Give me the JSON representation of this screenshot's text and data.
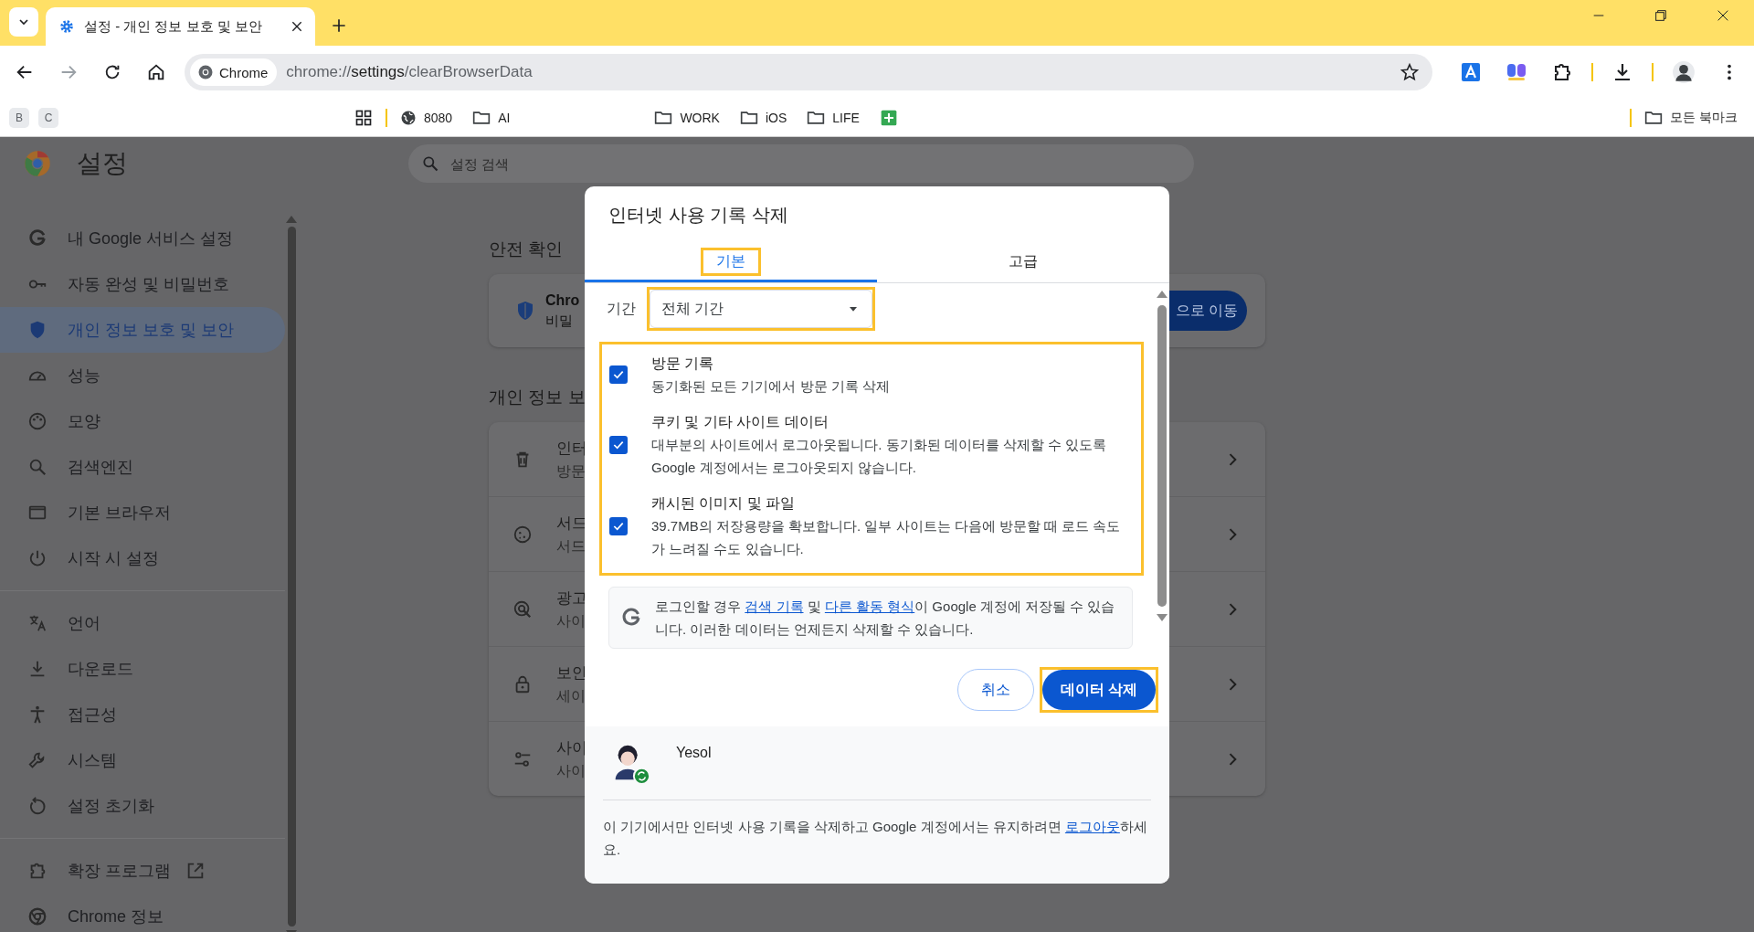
{
  "browser": {
    "tab": {
      "title": "설정 - 개인 정보 보호 및 보안"
    },
    "address": {
      "chip": "Chrome",
      "url": "chrome://**settings**/clearBrowserData"
    },
    "bookmarks_left": [
      "B",
      "C"
    ],
    "bookmarks": [
      {
        "kind": "apps"
      },
      {
        "kind": "site",
        "label": "8080"
      },
      {
        "kind": "folder",
        "label": "AI"
      },
      {
        "kind": "gap"
      },
      {
        "kind": "folder",
        "label": "WORK"
      },
      {
        "kind": "folder",
        "label": "iOS"
      },
      {
        "kind": "folder",
        "label": "LIFE"
      },
      {
        "kind": "sheet"
      }
    ],
    "all_bookmarks": "모든 북마크"
  },
  "settings": {
    "title": "설정",
    "search": {
      "placeholder": "설정 검색"
    },
    "sidebar": {
      "groups": [
        [
          {
            "label": "내 Google 서비스 설정",
            "selected": false
          },
          {
            "label": "자동 완성 및 비밀번호",
            "selected": false
          },
          {
            "label": "개인 정보 보호 및 보안",
            "selected": true
          },
          {
            "label": "성능",
            "selected": false
          },
          {
            "label": "모양",
            "selected": false
          },
          {
            "label": "검색엔진",
            "selected": false
          },
          {
            "label": "기본 브라우저",
            "selected": false
          },
          {
            "label": "시작 시 설정",
            "selected": false
          }
        ],
        [
          {
            "label": "언어",
            "selected": false
          },
          {
            "label": "다운로드",
            "selected": false
          },
          {
            "label": "접근성",
            "selected": false
          },
          {
            "label": "시스템",
            "selected": false
          },
          {
            "label": "설정 초기화",
            "selected": false
          }
        ],
        [
          {
            "label": "확장 프로그램",
            "selected": false,
            "external": true
          },
          {
            "label": "Chrome 정보",
            "selected": false,
            "external": false
          }
        ]
      ]
    },
    "safety": {
      "heading": "안전 확인",
      "title": "Chro",
      "subtitle": "비밀",
      "button": "으로 이동"
    },
    "privacy": {
      "heading": "개인 정보 보",
      "rows": [
        {
          "title": "인터",
          "subtitle": "방문"
        },
        {
          "title": "서드",
          "subtitle": "서드"
        },
        {
          "title": "광고",
          "subtitle": "사이"
        },
        {
          "title": "보안",
          "subtitle": "세이"
        },
        {
          "title": "사이",
          "subtitle": "사이"
        }
      ]
    }
  },
  "dialog": {
    "title": "인터넷 사용 기록 삭제",
    "tabs": [
      {
        "label": "기본",
        "selected": true,
        "highlighted": true
      },
      {
        "label": "고급",
        "selected": false,
        "highlighted": false
      }
    ],
    "period": {
      "label": "기간",
      "value": "전체 기간",
      "highlighted": true
    },
    "options": {
      "highlighted": true,
      "items": [
        {
          "kind": "checkbox",
          "title": "방문 기록",
          "description": "동기화된 모든 기기에서 방문 기록 삭제",
          "checked": true
        },
        {
          "kind": "checkbox",
          "title": "쿠키 및 기타 사이트 데이터",
          "description": "대부분의 사이트에서 로그아웃됩니다. 동기화된 데이터를 삭제할 수 있도록 Google 계정에서는 로그아웃되지 않습니다.",
          "checked": true
        },
        {
          "kind": "checkbox",
          "title": "캐시된 이미지 및 파일",
          "description": "39.7MB의 저장용량을 확보합니다. 일부 사이트는 다음에 방문할 때 로드 속도가 느려질 수도 있습니다.",
          "checked": true
        }
      ]
    },
    "notice": [
      {
        "text": "로그인할 경우 ",
        "link": false
      },
      {
        "text": "검색 기록",
        "link": true
      },
      {
        "text": " 및 ",
        "link": false
      },
      {
        "text": "다른 활동 형식",
        "link": true
      },
      {
        "text": "이 Google 계정에 저장될 수 있습니다. 이러한 데이터는 언제든지 삭제할 수 있습니다.",
        "link": false
      }
    ],
    "cancel_button": "취소",
    "delete_button": {
      "label": "데이터 삭제",
      "highlighted": true
    },
    "account": {
      "name": "Yesol"
    },
    "footer": [
      {
        "text": "이 기기에서만 인터넷 사용 기록을 삭제하고 Google 계정에서는 유지하려면 ",
        "link": false
      },
      {
        "text": "로그아웃",
        "link": true
      },
      {
        "text": "하세요.",
        "link": false
      }
    ]
  }
}
